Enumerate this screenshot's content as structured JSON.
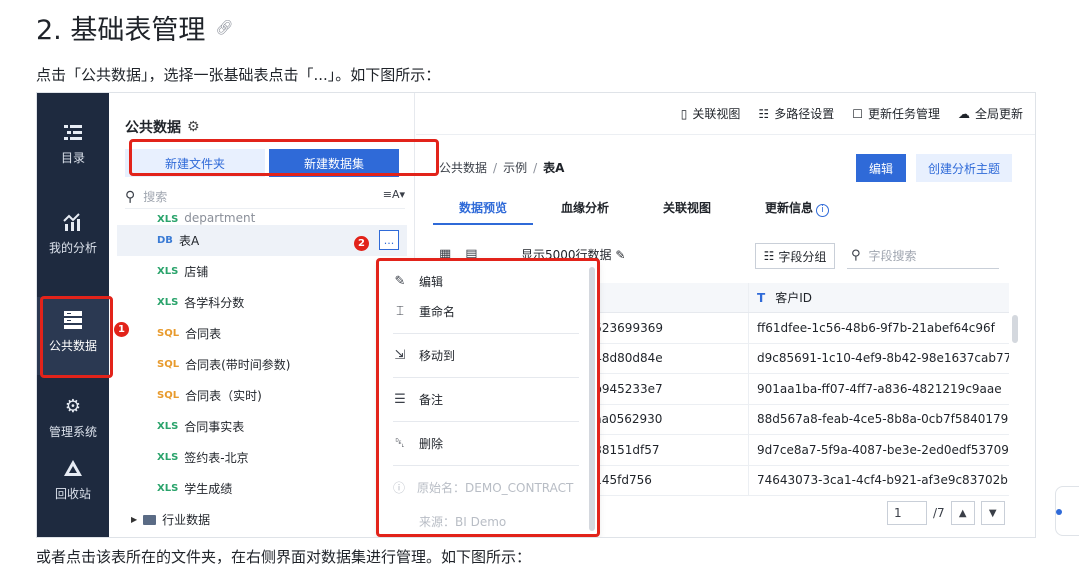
{
  "doc": {
    "title": "2. 基础表管理",
    "intro": "点击「公共数据」，选择一张基础表点击「...」。如下图所示：",
    "outro": "或者点击该表所在的文件夹，在右侧界面对数据集进行管理。如下图所示："
  },
  "nav": {
    "items": [
      {
        "label": "目录",
        "icon": "catalog-icon"
      },
      {
        "label": "我的分析",
        "icon": "analysis-icon"
      },
      {
        "label": "公共数据",
        "icon": "public-data-icon"
      },
      {
        "label": "管理系统",
        "icon": "settings-icon"
      },
      {
        "label": "回收站",
        "icon": "recycle-icon"
      }
    ]
  },
  "panel": {
    "title": "公共数据",
    "new_folder": "新建文件夹",
    "new_dataset": "新建数据集",
    "search_placeholder": "搜索",
    "sort_label": "A",
    "tree": [
      {
        "tag": "XLS",
        "label": "department"
      },
      {
        "tag": "DB",
        "label": "表A"
      },
      {
        "tag": "XLS",
        "label": "店铺"
      },
      {
        "tag": "XLS",
        "label": "各学科分数"
      },
      {
        "tag": "SQL",
        "label": "合同表"
      },
      {
        "tag": "SQL",
        "label": "合同表(带时间参数)"
      },
      {
        "tag": "SQL",
        "label": "合同表（实时)"
      },
      {
        "tag": "XLS",
        "label": "合同事实表"
      },
      {
        "tag": "XLS",
        "label": "签约表-北京"
      },
      {
        "tag": "XLS",
        "label": "学生成绩"
      }
    ],
    "folder": "行业数据",
    "more_label": "..."
  },
  "badges": {
    "one": "1",
    "two": "2"
  },
  "topbar": {
    "items": [
      {
        "label": "关联视图",
        "icon": "relation-icon"
      },
      {
        "label": "多路径设置",
        "icon": "multipath-icon"
      },
      {
        "label": "更新任务管理",
        "icon": "task-icon"
      },
      {
        "label": "全局更新",
        "icon": "cloud-icon"
      }
    ]
  },
  "breadcrumb": {
    "root": "公共数据",
    "mid": "示例",
    "current": "表A"
  },
  "actions": {
    "edit": "编辑",
    "create_theme": "创建分析主题"
  },
  "tabs": [
    "数据预览",
    "血缘分析",
    "关联视图",
    "更新信息"
  ],
  "preview": {
    "show_rows": "显示5000行数据",
    "field_group": "字段分组",
    "field_search": "字段搜索"
  },
  "grid": {
    "header_type": "T",
    "header_col2": "客户ID",
    "rows": [
      {
        "c1": "10523699369",
        "c2": "ff61dfee-1c56-48b6-9f7b-21abef64c96f"
      },
      {
        "c1": "7b48d80d84e",
        "c2": "d9c85691-1c10-4ef9-8b42-98e1637cab77"
      },
      {
        "c1": "dbb945233e7",
        "c2": "901aa1ba-ff07-4ff7-a836-4821219c9aae"
      },
      {
        "c1": "53aa0562930",
        "c2": "88d567a8-feab-4ce5-8b8a-0cb7f5840179"
      },
      {
        "c1": "1b38151df57",
        "c2": "9d7ce8a7-5f9a-4087-be3e-2ed0edf53709"
      },
      {
        "c1": "38145fd756",
        "c2": "74643073-3ca1-4cf4-b921-af3e9c83702b"
      }
    ]
  },
  "pager": {
    "page": "1",
    "total": "/7"
  },
  "menu": {
    "edit": "编辑",
    "rename": "重命名",
    "move_to": "移动到",
    "note": "备注",
    "delete": "删除",
    "original_name": "原始名：DEMO_CONTRACT",
    "source": "来源：BI Demo"
  },
  "colors": {
    "accent": "#2f6ad8",
    "nav_bg": "#1e2a3f",
    "highlight": "#e2231a"
  }
}
